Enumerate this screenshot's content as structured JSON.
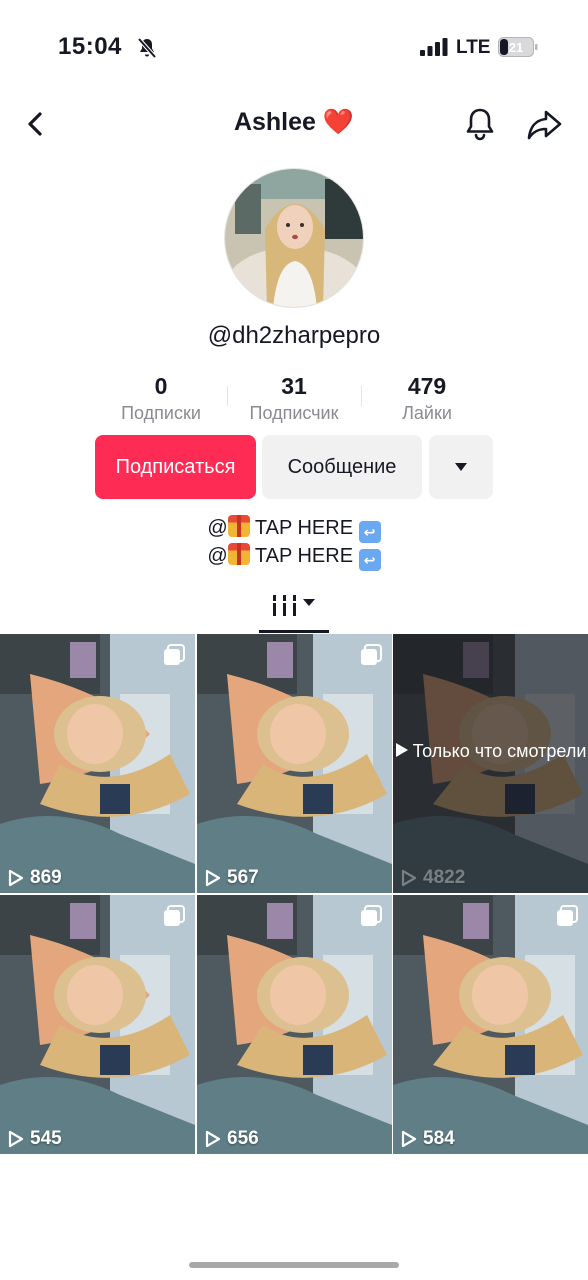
{
  "status_bar": {
    "time": "15:04",
    "network": "LTE",
    "battery_level": "21",
    "icons": [
      "bell-slash-icon",
      "signal-icon",
      "battery-icon"
    ]
  },
  "header": {
    "title": "Ashlee",
    "title_emoji": "❤️",
    "icons": [
      "back-arrow-icon",
      "bell-icon",
      "share-icon"
    ]
  },
  "profile": {
    "username": "@dh2zharpepro",
    "stats": [
      {
        "value": "0",
        "label": "Подписки"
      },
      {
        "value": "31",
        "label": "Подписчик"
      },
      {
        "value": "479",
        "label": "Лайки"
      }
    ],
    "buttons": {
      "follow": "Подписаться",
      "message": "Сообщение"
    },
    "bio_lines": [
      "@🎁 TAP HERE ↩️",
      "@🎁 TAP HERE ↩️"
    ],
    "bio_text": "TAP HERE"
  },
  "tabs": {
    "active": "videos-grid",
    "icons": [
      "grid-icon",
      "chevron-down-icon"
    ]
  },
  "videos": [
    {
      "views": "869",
      "pinned": true
    },
    {
      "views": "567",
      "pinned": true
    },
    {
      "views": "4822",
      "pinned": false,
      "overlay": "Только что смотрели"
    },
    {
      "views": "545",
      "pinned": true
    },
    {
      "views": "656",
      "pinned": true
    },
    {
      "views": "584",
      "pinned": true
    }
  ],
  "colors": {
    "accent": "#fe2c55",
    "secondary_button": "#f1f1f2",
    "text": "#161823",
    "muted": "#8a8b91"
  }
}
